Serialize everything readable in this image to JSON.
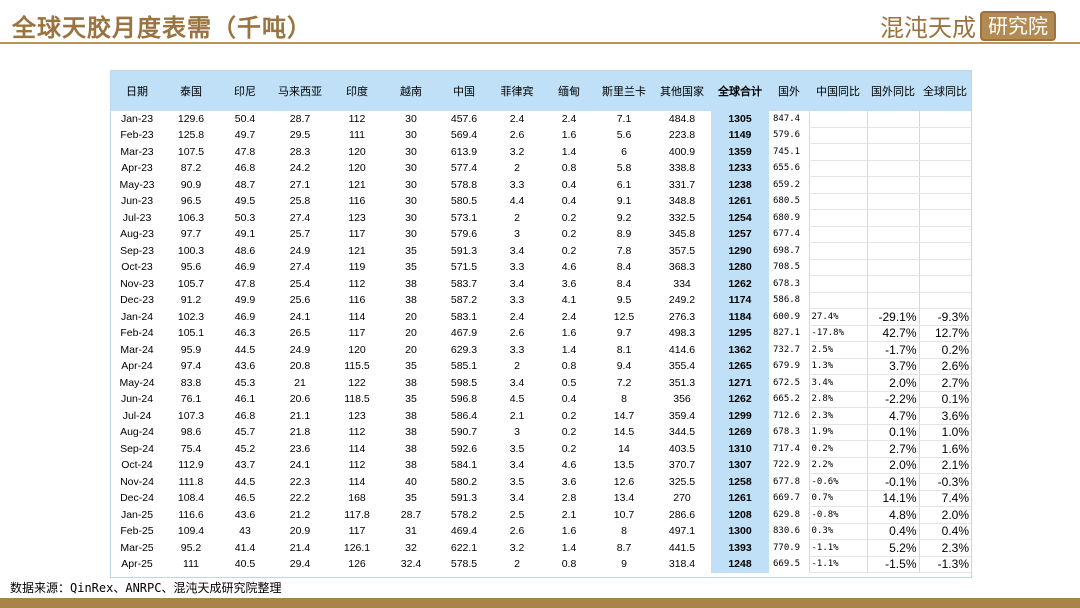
{
  "header": {
    "title": "全球天胶月度表需（千吨）",
    "brand_text": "混沌天成",
    "brand_seal": "研究院"
  },
  "table": {
    "columns": [
      "日期",
      "泰国",
      "印尼",
      "马来西亚",
      "印度",
      "越南",
      "中国",
      "菲律宾",
      "缅甸",
      "斯里兰卡",
      "其他国家",
      "全球合计",
      "国外",
      "中国同比",
      "国外同比",
      "全球同比"
    ],
    "rows": [
      [
        "Jan-23",
        "129.6",
        "50.4",
        "28.7",
        "112",
        "30",
        "457.6",
        "2.4",
        "2.4",
        "7.1",
        "484.8",
        "1305",
        "847.4",
        "",
        "",
        ""
      ],
      [
        "Feb-23",
        "125.8",
        "49.7",
        "29.5",
        "111",
        "30",
        "569.4",
        "2.6",
        "1.6",
        "5.6",
        "223.8",
        "1149",
        "579.6",
        "",
        "",
        ""
      ],
      [
        "Mar-23",
        "107.5",
        "47.8",
        "28.3",
        "120",
        "30",
        "613.9",
        "3.2",
        "1.4",
        "6",
        "400.9",
        "1359",
        "745.1",
        "",
        "",
        ""
      ],
      [
        "Apr-23",
        "87.2",
        "46.8",
        "24.2",
        "120",
        "30",
        "577.4",
        "2",
        "0.8",
        "5.8",
        "338.8",
        "1233",
        "655.6",
        "",
        "",
        ""
      ],
      [
        "May-23",
        "90.9",
        "48.7",
        "27.1",
        "121",
        "30",
        "578.8",
        "3.3",
        "0.4",
        "6.1",
        "331.7",
        "1238",
        "659.2",
        "",
        "",
        ""
      ],
      [
        "Jun-23",
        "96.5",
        "49.5",
        "25.8",
        "116",
        "30",
        "580.5",
        "4.4",
        "0.4",
        "9.1",
        "348.8",
        "1261",
        "680.5",
        "",
        "",
        ""
      ],
      [
        "Jul-23",
        "106.3",
        "50.3",
        "27.4",
        "123",
        "30",
        "573.1",
        "2",
        "0.2",
        "9.2",
        "332.5",
        "1254",
        "680.9",
        "",
        "",
        ""
      ],
      [
        "Aug-23",
        "97.7",
        "49.1",
        "25.7",
        "117",
        "30",
        "579.6",
        "3",
        "0.2",
        "8.9",
        "345.8",
        "1257",
        "677.4",
        "",
        "",
        ""
      ],
      [
        "Sep-23",
        "100.3",
        "48.6",
        "24.9",
        "121",
        "35",
        "591.3",
        "3.4",
        "0.2",
        "7.8",
        "357.5",
        "1290",
        "698.7",
        "",
        "",
        ""
      ],
      [
        "Oct-23",
        "95.6",
        "46.9",
        "27.4",
        "119",
        "35",
        "571.5",
        "3.3",
        "4.6",
        "8.4",
        "368.3",
        "1280",
        "708.5",
        "",
        "",
        ""
      ],
      [
        "Nov-23",
        "105.7",
        "47.8",
        "25.4",
        "112",
        "38",
        "583.7",
        "3.4",
        "3.6",
        "8.4",
        "334",
        "1262",
        "678.3",
        "",
        "",
        ""
      ],
      [
        "Dec-23",
        "91.2",
        "49.9",
        "25.6",
        "116",
        "38",
        "587.2",
        "3.3",
        "4.1",
        "9.5",
        "249.2",
        "1174",
        "586.8",
        "",
        "",
        ""
      ],
      [
        "Jan-24",
        "102.3",
        "46.9",
        "24.1",
        "114",
        "20",
        "583.1",
        "2.4",
        "2.4",
        "12.5",
        "276.3",
        "1184",
        "600.9",
        "27.4%",
        "-29.1%",
        "-9.3%"
      ],
      [
        "Feb-24",
        "105.1",
        "46.3",
        "26.5",
        "117",
        "20",
        "467.9",
        "2.6",
        "1.6",
        "9.7",
        "498.3",
        "1295",
        "827.1",
        "-17.8%",
        "42.7%",
        "12.7%"
      ],
      [
        "Mar-24",
        "95.9",
        "44.5",
        "24.9",
        "120",
        "20",
        "629.3",
        "3.3",
        "1.4",
        "8.1",
        "414.6",
        "1362",
        "732.7",
        "2.5%",
        "-1.7%",
        "0.2%"
      ],
      [
        "Apr-24",
        "97.4",
        "43.6",
        "20.8",
        "115.5",
        "35",
        "585.1",
        "2",
        "0.8",
        "9.4",
        "355.4",
        "1265",
        "679.9",
        "1.3%",
        "3.7%",
        "2.6%"
      ],
      [
        "May-24",
        "83.8",
        "45.3",
        "21",
        "122",
        "38",
        "598.5",
        "3.4",
        "0.5",
        "7.2",
        "351.3",
        "1271",
        "672.5",
        "3.4%",
        "2.0%",
        "2.7%"
      ],
      [
        "Jun-24",
        "76.1",
        "46.1",
        "20.6",
        "118.5",
        "35",
        "596.8",
        "4.5",
        "0.4",
        "8",
        "356",
        "1262",
        "665.2",
        "2.8%",
        "-2.2%",
        "0.1%"
      ],
      [
        "Jul-24",
        "107.3",
        "46.8",
        "21.1",
        "123",
        "38",
        "586.4",
        "2.1",
        "0.2",
        "14.7",
        "359.4",
        "1299",
        "712.6",
        "2.3%",
        "4.7%",
        "3.6%"
      ],
      [
        "Aug-24",
        "98.6",
        "45.7",
        "21.8",
        "112",
        "38",
        "590.7",
        "3",
        "0.2",
        "14.5",
        "344.5",
        "1269",
        "678.3",
        "1.9%",
        "0.1%",
        "1.0%"
      ],
      [
        "Sep-24",
        "75.4",
        "45.2",
        "23.6",
        "114",
        "38",
        "592.6",
        "3.5",
        "0.2",
        "14",
        "403.5",
        "1310",
        "717.4",
        "0.2%",
        "2.7%",
        "1.6%"
      ],
      [
        "Oct-24",
        "112.9",
        "43.7",
        "24.1",
        "112",
        "38",
        "584.1",
        "3.4",
        "4.6",
        "13.5",
        "370.7",
        "1307",
        "722.9",
        "2.2%",
        "2.0%",
        "2.1%"
      ],
      [
        "Nov-24",
        "111.8",
        "44.5",
        "22.3",
        "114",
        "40",
        "580.2",
        "3.5",
        "3.6",
        "12.6",
        "325.5",
        "1258",
        "677.8",
        "-0.6%",
        "-0.1%",
        "-0.3%"
      ],
      [
        "Dec-24",
        "108.4",
        "46.5",
        "22.2",
        "168",
        "35",
        "591.3",
        "3.4",
        "2.8",
        "13.4",
        "270",
        "1261",
        "669.7",
        "0.7%",
        "14.1%",
        "7.4%"
      ],
      [
        "Jan-25",
        "116.6",
        "43.6",
        "21.2",
        "117.8",
        "28.7",
        "578.2",
        "2.5",
        "2.1",
        "10.7",
        "286.6",
        "1208",
        "629.8",
        "-0.8%",
        "4.8%",
        "2.0%"
      ],
      [
        "Feb-25",
        "109.4",
        "43",
        "20.9",
        "117",
        "31",
        "469.4",
        "2.6",
        "1.6",
        "8",
        "497.1",
        "1300",
        "830.6",
        "0.3%",
        "0.4%",
        "0.4%"
      ],
      [
        "Mar-25",
        "95.2",
        "41.4",
        "21.4",
        "126.1",
        "32",
        "622.1",
        "3.2",
        "1.4",
        "8.7",
        "441.5",
        "1393",
        "770.9",
        "-1.1%",
        "5.2%",
        "2.3%"
      ],
      [
        "Apr-25",
        "111",
        "40.5",
        "29.4",
        "126",
        "32.4",
        "578.5",
        "2",
        "0.8",
        "9",
        "318.4",
        "1248",
        "669.5",
        "-1.1%",
        "-1.5%",
        "-1.3%"
      ]
    ]
  },
  "footer": {
    "source": "数据来源：QinRex、ANRPC、混沌天成研究院整理"
  }
}
